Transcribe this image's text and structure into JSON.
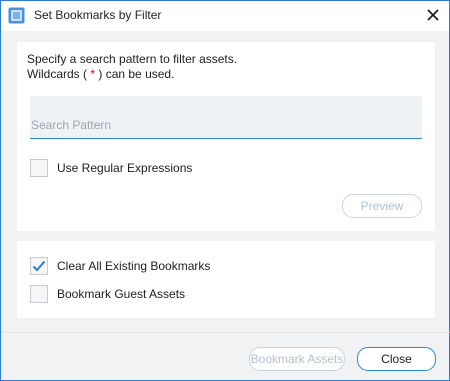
{
  "window": {
    "title": "Set Bookmarks by Filter"
  },
  "filter": {
    "description_line1": "Specify a search pattern to filter assets.",
    "description_line2_prefix": "Wildcards (",
    "description_wildcard": "*",
    "description_line2_suffix": ") can be used.",
    "search_placeholder": "Search Pattern",
    "search_value": "",
    "regex_label": "Use Regular Expressions",
    "regex_checked": false,
    "preview_label": "Preview"
  },
  "options": {
    "clear_label": "Clear All Existing Bookmarks",
    "clear_checked": true,
    "guest_label": "Bookmark Guest Assets",
    "guest_checked": false
  },
  "footer": {
    "bookmark_label": "Bookmark Assets",
    "close_label": "Close"
  },
  "colors": {
    "accent": "#2b8bd8",
    "disabled_text": "#b3c2cf",
    "wildcard": "#d0021b"
  }
}
